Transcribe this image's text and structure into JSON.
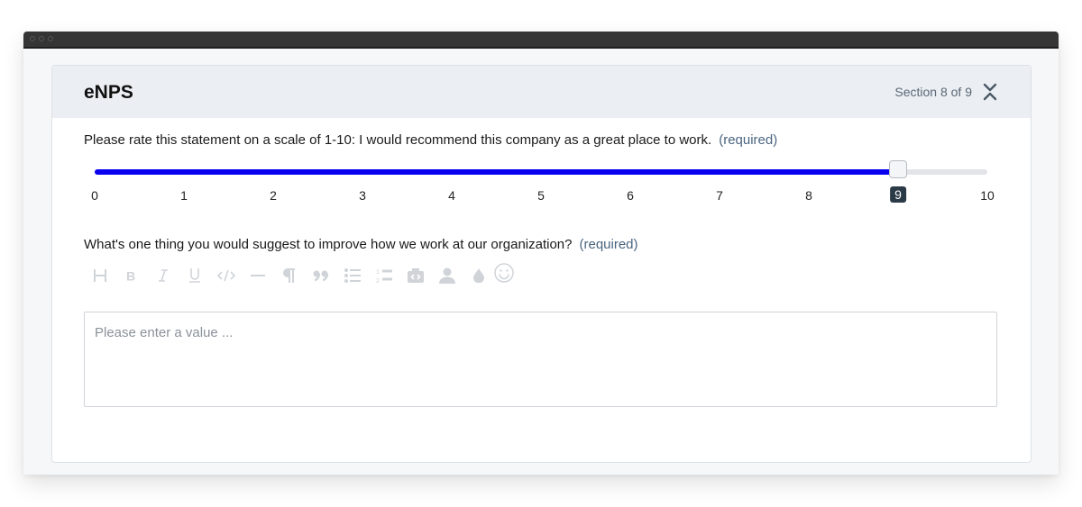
{
  "window": {
    "controls": [
      "close",
      "minimize",
      "maximize"
    ]
  },
  "section": {
    "title": "eNPS",
    "progress_text": "Section 8 of 9",
    "collapse_icon": "collapse-icon"
  },
  "question1": {
    "label": "Please rate this statement on a scale of 1-10: I would recommend this company as a great place to work.",
    "required": "(required)",
    "slider": {
      "min": 0,
      "max": 10,
      "value": 9,
      "ticks": [
        "0",
        "1",
        "2",
        "3",
        "4",
        "5",
        "6",
        "7",
        "8",
        "9",
        "10"
      ],
      "fill_color": "#0a00f0"
    }
  },
  "question2": {
    "label": "What's one thing you would suggest to improve how we work at our organization?",
    "required": "(required)",
    "toolbar": [
      {
        "name": "heading",
        "icon": "heading-icon"
      },
      {
        "name": "bold",
        "icon": "bold-icon"
      },
      {
        "name": "italic",
        "icon": "italic-icon"
      },
      {
        "name": "underline",
        "icon": "underline-icon"
      },
      {
        "name": "code",
        "icon": "code-icon"
      },
      {
        "name": "horizontal-rule",
        "icon": "horizontal-rule-icon"
      },
      {
        "name": "paragraph",
        "icon": "paragraph-icon"
      },
      {
        "name": "quote",
        "icon": "quote-icon"
      },
      {
        "name": "bullet-list",
        "icon": "bullet-list-icon"
      },
      {
        "name": "numbered-list",
        "icon": "numbered-list-icon"
      },
      {
        "name": "embed",
        "icon": "camera-icon"
      },
      {
        "name": "mention",
        "icon": "user-icon"
      },
      {
        "name": "color",
        "icon": "droplet-icon"
      },
      {
        "name": "emoji",
        "icon": "emoji-icon"
      }
    ],
    "placeholder": "Please enter a value ...",
    "value": ""
  }
}
